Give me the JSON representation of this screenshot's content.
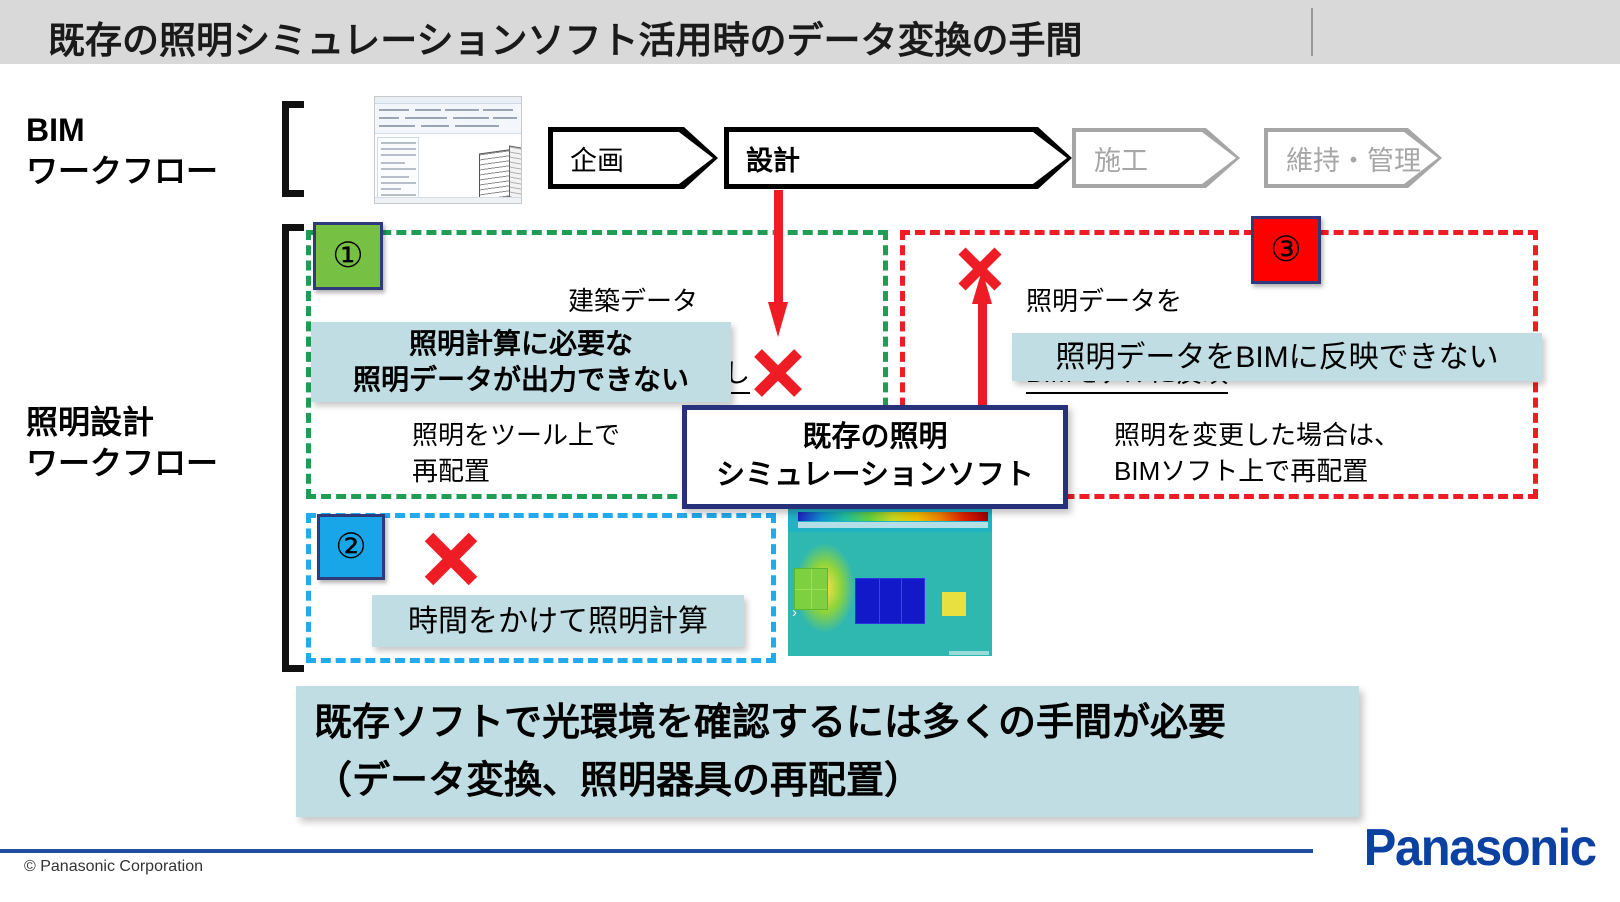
{
  "slide": {
    "title": "既存の照明シミュレーションソフト活用時のデータ変換の手間"
  },
  "rows": {
    "bim_label": "BIM\nワークフロー",
    "lighting_label": "照明設計\nワークフロー"
  },
  "bim_workflow": {
    "thumbnail_name": "bim-model-screenshot",
    "stages": [
      {
        "label": "企画",
        "state": "active"
      },
      {
        "label": "設計",
        "state": "active-bold"
      },
      {
        "label": "施工",
        "state": "inactive"
      },
      {
        "label": "維持・管理",
        "state": "inactive"
      }
    ]
  },
  "regions": {
    "one": {
      "badge": "①",
      "badge_color": "#76c043",
      "border_color": "#1f9d55",
      "step_text_line1": "建築データ",
      "step_text_line2": "照明データ書き出し",
      "problem_text": "照明計算に必要な\n照明データが出力できない",
      "next_text": "照明をツール上で\n再配置"
    },
    "two": {
      "badge": "②",
      "badge_color": "#19a6e8",
      "border_color": "#22aaee",
      "problem_text": "時間をかけて照明計算",
      "sim_image_name": "lighting-simulation-render"
    },
    "three": {
      "badge": "③",
      "badge_color": "#ff0000",
      "border_color": "#ee1c25",
      "step_text_line1": "照明データを",
      "step_text_line2": "BIMモデルに反映",
      "problem_text": "照明データをBIMに反映できない",
      "next_text": "照明を変更した場合は、\nBIMソフト上で再配置"
    }
  },
  "center_box": {
    "text": "既存の照明\nシミュレーションソフト",
    "border_color": "#27307a"
  },
  "markers": {
    "x_mark": "×",
    "x_color": "#ee1c25",
    "arrow_color": "#ee1c25"
  },
  "conclusion": {
    "line1": "既存ソフトで光環境を確認するには多くの手間が必要",
    "line2": "（データ変換、照明器具の再配置）",
    "bg_color": "#bfdde2"
  },
  "footer": {
    "copyright": "© Panasonic Corporation",
    "brand": "Panasonic",
    "brand_color": "#0b41a0",
    "rule_color": "#1f4e9c"
  }
}
